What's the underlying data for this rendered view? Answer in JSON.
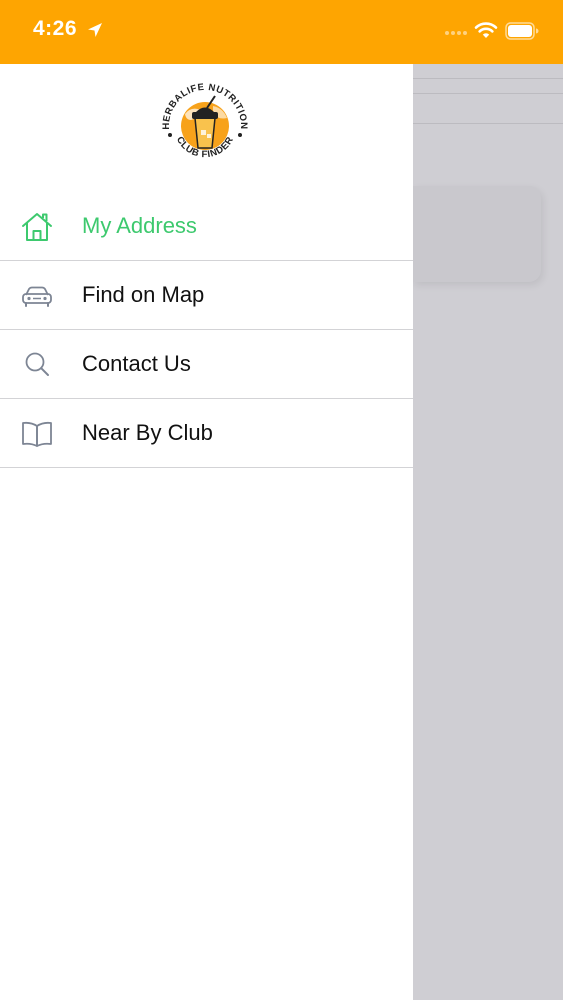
{
  "status_bar": {
    "time": "4:26",
    "icons": [
      "location-arrow-icon",
      "cellular-signal-icon",
      "wifi-icon",
      "battery-icon"
    ],
    "background_color": "#fea501"
  },
  "drawer": {
    "logo": {
      "text_top": "HERBALIFE NUTRITION",
      "text_bottom": "CLUB FINDER"
    },
    "menu_items": [
      {
        "label": "My Address",
        "icon": "home-icon",
        "active": true
      },
      {
        "label": "Find on Map",
        "icon": "car-icon",
        "active": false
      },
      {
        "label": "Contact Us",
        "icon": "search-icon",
        "active": false
      },
      {
        "label": "Near By Club",
        "icon": "book-icon",
        "active": false
      }
    ],
    "active_color": "#3dc96e",
    "icon_color": "#7d8594"
  }
}
